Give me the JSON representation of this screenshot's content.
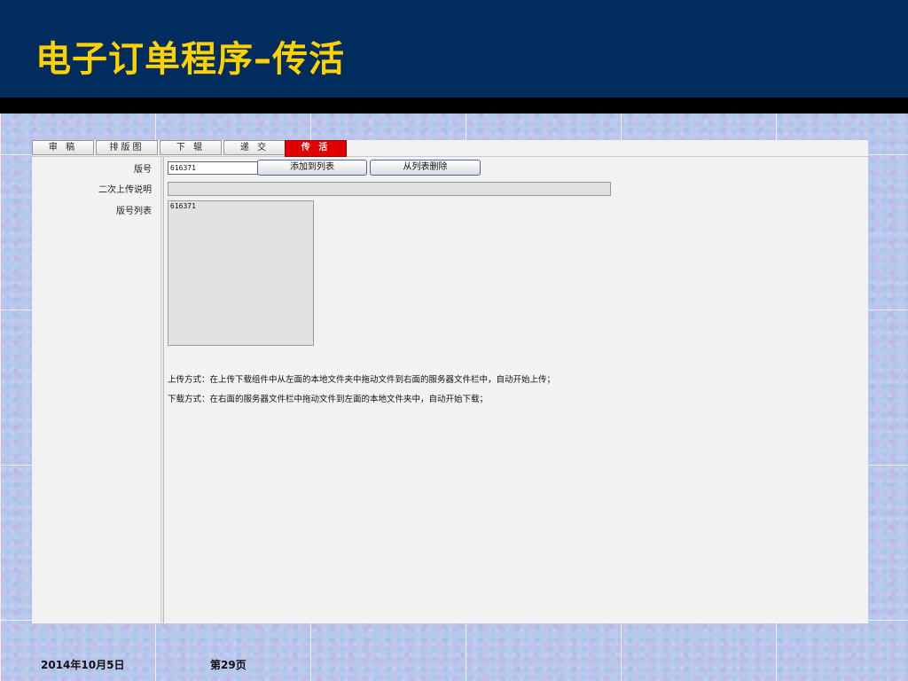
{
  "slide": {
    "title": "电子订单程序–传活",
    "footer_date": "2014年10月5日",
    "footer_page": "第29页"
  },
  "colors": {
    "header_bg": "#002d5e",
    "title_color": "#ffd100",
    "active_tab": "#e00000"
  },
  "tabs": [
    {
      "label": "审 稿",
      "active": false
    },
    {
      "label": "排版图",
      "active": false
    },
    {
      "label": "下 辊",
      "active": false
    },
    {
      "label": "递 交",
      "active": false
    },
    {
      "label": "传 活",
      "active": true
    }
  ],
  "form": {
    "edition_label": "版号",
    "edition_value": "616371",
    "add_button": "添加到列表",
    "remove_button": "从列表删除",
    "note_label": "二次上传说明",
    "note_value": "",
    "list_label": "版号列表",
    "list_items": [
      "616371"
    ]
  },
  "instructions": {
    "upload": "上传方式：在上传下载组件中从左面的本地文件夹中拖动文件到右面的服务器文件栏中，自动开始上传；",
    "download": "下载方式：在右面的服务器文件栏中拖动文件到左面的本地文件夹中，自动开始下载；"
  }
}
